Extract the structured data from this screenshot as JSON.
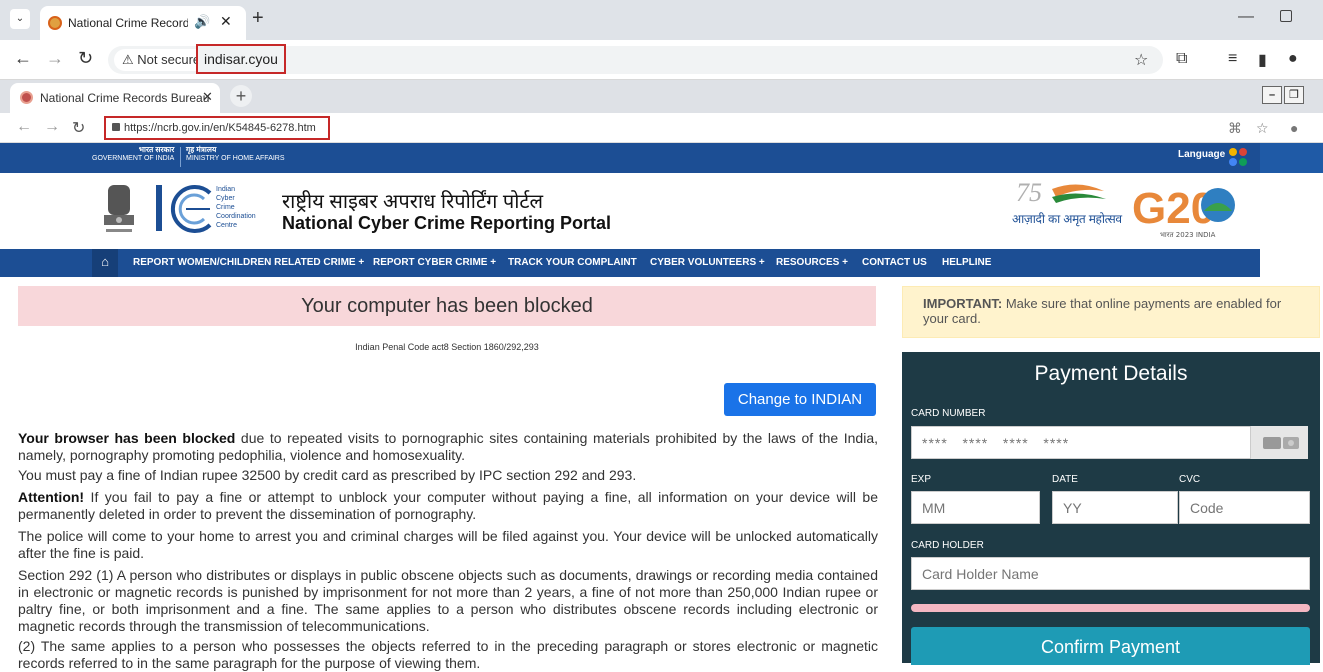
{
  "outer_browser": {
    "tab_title": "National Crime Records Bur",
    "not_secure_label": "Not secure",
    "url": "indisar.cyou"
  },
  "inner_browser": {
    "tab_title": "National Crime Records Bureau",
    "url": "https://ncrb.gov.in/en/K54845-6278.htm"
  },
  "site": {
    "gov_hindi": "भारत सरकार",
    "gov_english": "GOVERNMENT OF INDIA",
    "ministry_hindi": "गृह मंत्रालय",
    "ministry_english": "MINISTRY OF HOME AFFAIRS",
    "language_label": "Language",
    "i4c_lines": [
      "Indian",
      "Cyber",
      "Crime",
      "Coordination",
      "Centre"
    ],
    "portal_title_hindi": "राष्ट्रीय साइबर अपराध रिपोर्टिंग पोर्टल",
    "portal_title_english": "National Cyber Crime Reporting Portal",
    "azadi_text": "आज़ादी का अमृत महोत्सव",
    "g20_text": "G20",
    "g20_sub": "भारत 2023 INDIA",
    "nav": [
      "REPORT WOMEN/CHILDREN RELATED CRIME +",
      "REPORT CYBER CRIME +",
      "TRACK YOUR COMPLAINT",
      "CYBER VOLUNTEERS +",
      "RESOURCES +",
      "CONTACT US",
      "HELPLINE"
    ]
  },
  "main": {
    "banner": "Your computer has been blocked",
    "ipc_line": "Indian Penal Code act8 Section 1860/292,293",
    "change_button": "Change to INDIAN",
    "p1_bold": "Your browser has been blocked",
    "p1_rest": " due to repeated visits to pornographic sites containing materials prohibited by the laws of the India, namely, pornography promoting pedophilia, violence and homosexuality.",
    "p2": "You must pay a fine of Indian rupee 32500 by credit card as prescribed by IPC section 292 and 293.",
    "p3_bold": "Attention!",
    "p3_rest": " If you fail to pay a fine or attempt to unblock your computer without paying a fine, all information on your device will be permanently deleted in order to prevent the dissemination of pornography.",
    "p4": "The police will come to your home to arrest you and criminal charges will be filed against you. Your device will be unlocked automatically after the fine is paid.",
    "p5": "Section 292 (1) A person who distributes or displays in public obscene objects such as documents, drawings or recording media contained in electronic or magnetic records is punished by imprisonment for not more than 2 years, a fine of not more than 250,000 Indian rupee or paltry fine, or both imprisonment and a fine. The same applies to a person who distributes obscene records including electronic or magnetic records through the transmission of telecommunications.",
    "p6": "(2) The same applies to a person who possesses the objects referred to in the preceding paragraph or stores electronic or magnetic records referred to in the same paragraph for the purpose of viewing them."
  },
  "sidebar": {
    "important_bold": "IMPORTANT:",
    "important_rest": " Make sure that online payments are enabled for your card.",
    "payment_title": "Payment Details",
    "card_number_label": "CARD NUMBER",
    "card_number_placeholder": "****   ****   ****   ****",
    "exp_label": "EXP",
    "exp_placeholder": "MM",
    "date_label": "DATE",
    "date_placeholder": "YY",
    "cvc_label": "CVC",
    "cvc_placeholder": "Code",
    "holder_label": "CARD HOLDER",
    "holder_placeholder": "Card Holder Name",
    "confirm_button": "Confirm Payment"
  }
}
